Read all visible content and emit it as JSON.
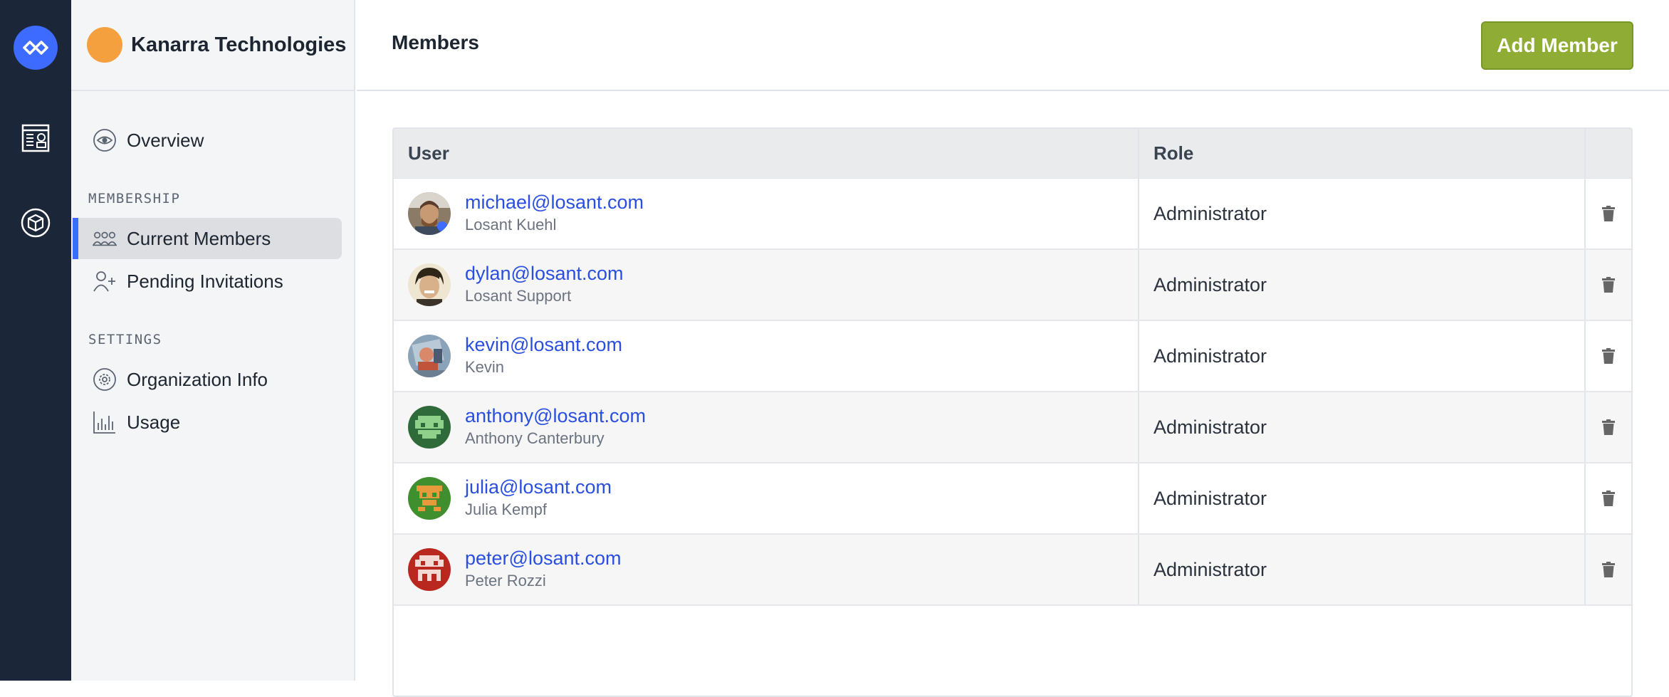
{
  "org": {
    "name": "Kanarra Technologies",
    "dot_color": "#f4a03f"
  },
  "nav": {
    "overview": "Overview",
    "membership_section": "MEMBERSHIP",
    "current_members": "Current Members",
    "pending_invitations": "Pending Invitations",
    "settings_section": "SETTINGS",
    "organization_info": "Organization Info",
    "usage": "Usage"
  },
  "header": {
    "title": "Members",
    "add_button": "Add Member"
  },
  "table": {
    "columns": [
      "User",
      "Role",
      ""
    ],
    "rows": [
      {
        "email": "michael@losant.com",
        "name": "Losant Kuehl",
        "role": "Administrator",
        "avatar": "photo-avatar"
      },
      {
        "email": "dylan@losant.com",
        "name": "Losant Support",
        "role": "Administrator",
        "avatar": "photo-avatar"
      },
      {
        "email": "kevin@losant.com",
        "name": "Kevin",
        "role": "Administrator",
        "avatar": "photo-avatar"
      },
      {
        "email": "anthony@losant.com",
        "name": "Anthony Canterbury",
        "role": "Administrator",
        "avatar": "pixel-avatar"
      },
      {
        "email": "julia@losant.com",
        "name": "Julia Kempf",
        "role": "Administrator",
        "avatar": "pixel-avatar"
      },
      {
        "email": "peter@losant.com",
        "name": "Peter Rozzi",
        "role": "Administrator",
        "avatar": "pixel-avatar"
      }
    ]
  },
  "colors": {
    "accent": "#3d6aff",
    "rail": "#1b2638",
    "add_button": "#8fac34",
    "link": "#2a4fe0"
  }
}
